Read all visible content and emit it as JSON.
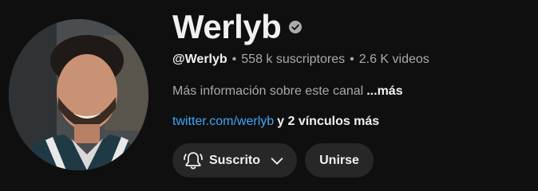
{
  "channel": {
    "name": "Werlyb",
    "handle": "@Werlyb",
    "subscribers": "558 k suscriptores",
    "videos": "2.6 K videos",
    "separator": "•",
    "description": "Más información sobre este canal",
    "description_more": "...más",
    "link": "twitter.com/werlyb",
    "more_links": "y 2 vínculos más"
  },
  "actions": {
    "subscribed_label": "Suscrito",
    "join_label": "Unirse"
  },
  "icons": {
    "verified": "verified-checkmark-icon",
    "bell": "bell-icon",
    "chevron": "chevron-down-icon"
  },
  "colors": {
    "background": "#0f0f0f",
    "button": "#272727",
    "link": "#3ea6ff",
    "secondary_text": "#aaaaaa"
  }
}
